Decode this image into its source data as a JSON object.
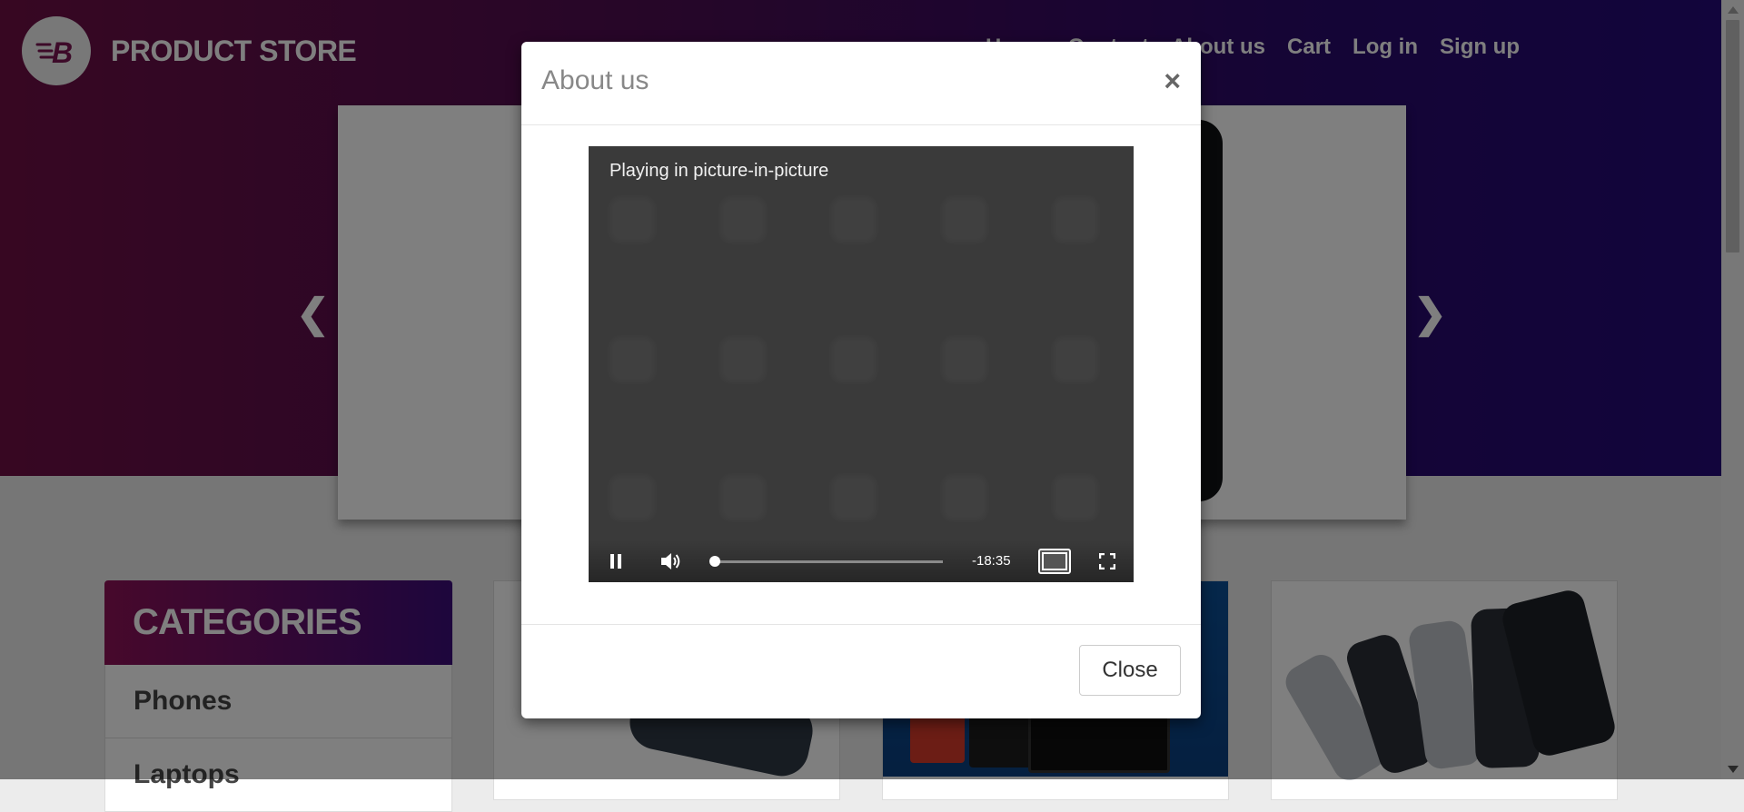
{
  "brand": {
    "name": "PRODUCT STORE",
    "logo_letter": "B"
  },
  "nav": {
    "items": [
      "Home",
      "Contact",
      "About us",
      "Cart",
      "Log in",
      "Sign up"
    ]
  },
  "carousel": {
    "prev_icon": "chevron-left-icon",
    "next_icon": "chevron-right-icon"
  },
  "categories": {
    "title": "CATEGORIES",
    "items": [
      "Phones",
      "Laptops"
    ]
  },
  "modal": {
    "title": "About us",
    "close_symbol": "×",
    "close_button_label": "Close",
    "video": {
      "status_text": "Playing in picture-in-picture",
      "time_remaining": "-18:35",
      "progress": 0.02,
      "state": "playing"
    }
  },
  "colors": {
    "header_start": "#6f0f45",
    "header_end": "#240a78",
    "overlay": "rgba(0,0,0,0.5)"
  }
}
